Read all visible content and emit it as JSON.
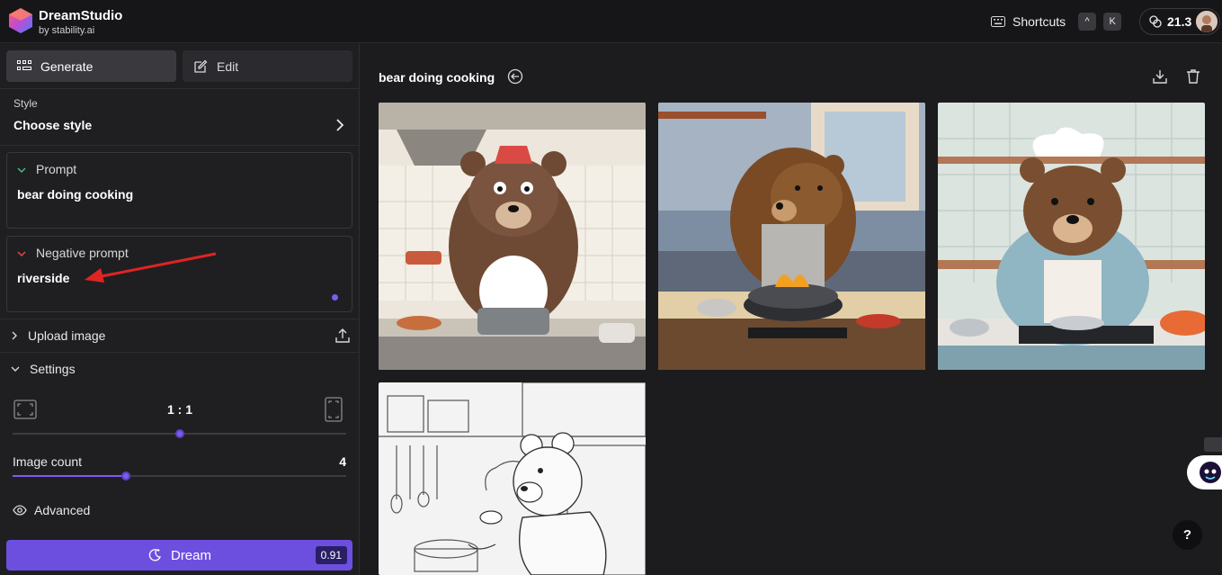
{
  "header": {
    "app_title": "DreamStudio",
    "app_subtitle": "by stability.ai",
    "shortcuts_label": "Shortcuts",
    "shortcut_key_1": "^",
    "shortcut_key_2": "K",
    "credits": "21.3"
  },
  "tabs": {
    "generate_label": "Generate",
    "edit_label": "Edit",
    "active": "Generate"
  },
  "style": {
    "label": "Style",
    "value": "Choose style"
  },
  "prompt": {
    "title": "Prompt",
    "value": "bear doing cooking"
  },
  "negative_prompt": {
    "title": "Negative prompt",
    "value": "riverside"
  },
  "upload": {
    "label": "Upload image"
  },
  "settings": {
    "label": "Settings",
    "aspect_ratio": "1 : 1",
    "aspect_ratio_fraction": 0.5,
    "image_count_label": "Image count",
    "image_count_value": "4",
    "image_count_fraction": 0.34,
    "advanced_label": "Advanced"
  },
  "dream": {
    "label": "Dream",
    "cost": "0.91"
  },
  "results": {
    "title": "bear doing cooking",
    "images": [
      {
        "alt": "cartoon bear in chef hat stirring pot",
        "style": "cartoon"
      },
      {
        "alt": "realistic bear cooking at stove",
        "style": "realistic"
      },
      {
        "alt": "illustrated bear chef in kitchen",
        "style": "illustration"
      },
      {
        "alt": "sketch bear cooking",
        "style": "sketch"
      }
    ]
  },
  "help_label": "?",
  "colors": {
    "accent": "#6d4fe0",
    "background": "#1c1c1e",
    "sidebar": "#1f1f22",
    "annotation_arrow": "#e02424"
  }
}
